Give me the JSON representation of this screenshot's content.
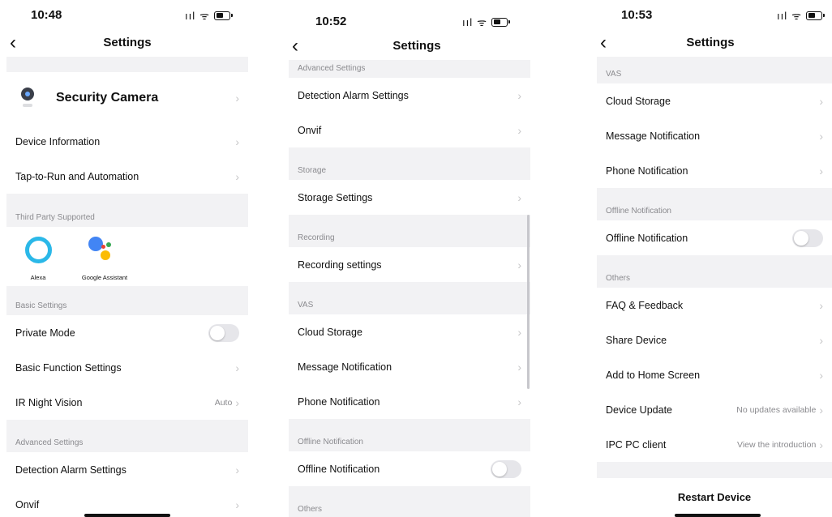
{
  "screens": [
    {
      "time": "10:48",
      "nav_title": "Settings",
      "device_name": "Security Camera",
      "rows_top": [
        {
          "label": "Device Information"
        },
        {
          "label": "Tap-to-Run and Automation"
        }
      ],
      "third_party_header": "Third Party Supported",
      "third_party": [
        {
          "label": "Alexa",
          "icon": "alexa-icon"
        },
        {
          "label": "Google Assistant",
          "icon": "google-assistant-icon"
        }
      ],
      "basic_header": "Basic Settings",
      "basic_rows": [
        {
          "label": "Private Mode",
          "toggle": "off"
        },
        {
          "label": "Basic Function Settings"
        },
        {
          "label": "IR Night Vision",
          "value": "Auto"
        }
      ],
      "advanced_header": "Advanced Settings",
      "advanced_rows": [
        {
          "label": "Detection Alarm Settings"
        },
        {
          "label": "Onvif"
        }
      ]
    },
    {
      "time": "10:52",
      "nav_title": "Settings",
      "advanced_header": "Advanced Settings",
      "advanced_rows": [
        {
          "label": "Detection Alarm Settings"
        },
        {
          "label": "Onvif"
        }
      ],
      "storage_header": "Storage",
      "storage_rows": [
        {
          "label": "Storage Settings"
        }
      ],
      "recording_header": "Recording",
      "recording_rows": [
        {
          "label": "Recording settings"
        }
      ],
      "vas_header": "VAS",
      "vas_rows": [
        {
          "label": "Cloud Storage"
        },
        {
          "label": "Message Notification"
        },
        {
          "label": "Phone Notification"
        }
      ],
      "offline_header": "Offline Notification",
      "offline_rows": [
        {
          "label": "Offline Notification",
          "toggle": "off"
        }
      ],
      "others_header": "Others"
    },
    {
      "time": "10:53",
      "nav_title": "Settings",
      "vas_header": "VAS",
      "vas_rows": [
        {
          "label": "Cloud Storage"
        },
        {
          "label": "Message Notification"
        },
        {
          "label": "Phone Notification"
        }
      ],
      "offline_header": "Offline Notification",
      "offline_rows": [
        {
          "label": "Offline Notification",
          "toggle": "off"
        }
      ],
      "others_header": "Others",
      "others_rows": [
        {
          "label": "FAQ & Feedback"
        },
        {
          "label": "Share Device"
        },
        {
          "label": "Add to Home Screen"
        },
        {
          "label": "Device Update",
          "value": "No updates available"
        },
        {
          "label": "IPC PC client",
          "value": "View the introduction"
        }
      ],
      "restart_label": "Restart Device"
    }
  ],
  "status_icons": [
    "signal-icon",
    "wifi-icon",
    "battery-icon"
  ],
  "glyphs": {
    "back": "‹",
    "chevron": "›",
    "signal": "ııl",
    "wifi": "ᯤ"
  },
  "colors": {
    "section_bg": "#f2f2f4",
    "secondary_text": "#8a8a8e",
    "alexa": "#2bb8e8",
    "toggle_off": "#e6e6ea"
  }
}
